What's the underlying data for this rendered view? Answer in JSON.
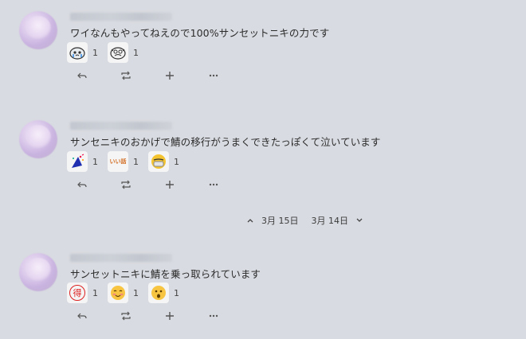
{
  "notes": [
    {
      "text": "ワイなんもやってねえので100%サンセットニキの力です",
      "reactions": [
        {
          "icon": "crying-tofu-emoji",
          "count": "1"
        },
        {
          "icon": "scared-tofu-emoji",
          "count": "1"
        }
      ]
    },
    {
      "text": "サンセニキのおかげで鯖の移行がうまくできたっぽくて泣いています",
      "reactions": [
        {
          "icon": "party-popper-emoji",
          "count": "1"
        },
        {
          "icon": "ii-hanashi-emoji",
          "count": "1"
        },
        {
          "icon": "mask-face-emoji",
          "count": "1"
        }
      ]
    },
    {
      "text": "サンセットニキに鯖を乗っ取られています",
      "reactions": [
        {
          "icon": "toku-stamp-emoji",
          "count": "1"
        },
        {
          "icon": "blushing-face-emoji",
          "count": "1"
        },
        {
          "icon": "surprised-face-emoji",
          "count": "1"
        }
      ]
    }
  ],
  "date_nav": {
    "prev": "3月 15日",
    "next": "3月 14日"
  },
  "emoji_labels": {
    "ii_hanashi": "いい話",
    "toku": "得"
  }
}
